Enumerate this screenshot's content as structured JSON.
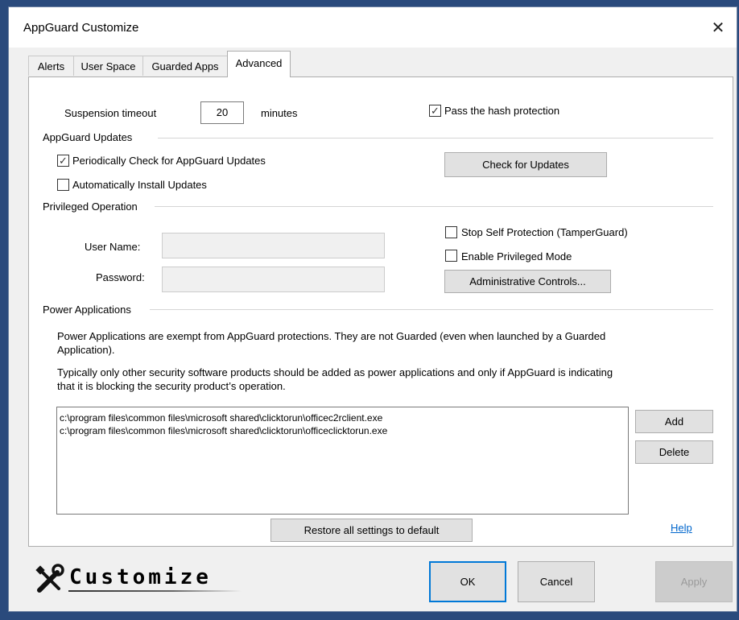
{
  "window": {
    "title": "AppGuard Customize"
  },
  "tabs": [
    {
      "label": "Alerts"
    },
    {
      "label": "User Space"
    },
    {
      "label": "Guarded Apps"
    },
    {
      "label": "Advanced"
    }
  ],
  "suspension": {
    "label": "Suspension timeout",
    "value": "20",
    "unit": "minutes"
  },
  "pass_hash": {
    "label": "Pass the hash protection",
    "checked": true
  },
  "updates": {
    "group_label": "AppGuard Updates",
    "periodic_label": "Periodically Check for AppGuard Updates",
    "periodic_checked": true,
    "auto_label": "Automatically Install Updates",
    "auto_checked": false,
    "check_button": "Check for Updates"
  },
  "privileged": {
    "group_label": "Privileged Operation",
    "username_label": "User Name:",
    "password_label": "Password:",
    "stop_self_label": "Stop Self Protection (TamperGuard)",
    "privileged_mode_label": "Enable Privileged Mode",
    "admin_button": "Administrative Controls..."
  },
  "power": {
    "group_label": "Power Applications",
    "desc1": "Power Applications are exempt from AppGuard protections.  They are not Guarded (even when launched by a Guarded Application).",
    "desc2": "Typically only other security software products should be added as power applications and only if AppGuard is indicating that it is blocking the security product’s operation.",
    "items": [
      "c:\\program files\\common files\\microsoft shared\\clicktorun\\officec2rclient.exe",
      "c:\\program files\\common files\\microsoft shared\\clicktorun\\officeclicktorun.exe"
    ],
    "add_button": "Add",
    "delete_button": "Delete"
  },
  "restore_button": "Restore all settings to default",
  "help_link": "Help",
  "footer": {
    "logo_text": "Customize",
    "ok": "OK",
    "cancel": "Cancel",
    "apply": "Apply"
  },
  "icons": {
    "close": "close-icon",
    "logo": "tools-icon"
  }
}
